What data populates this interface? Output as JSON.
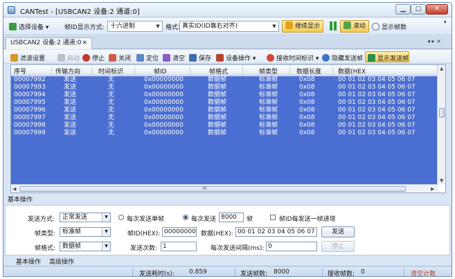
{
  "window": {
    "title": "CANTest - [USBCAN2 设备:2 通道:0]"
  },
  "toolbar1": {
    "select_device": "选择设备",
    "id_display_label": "帧ID显示方式:",
    "id_display_value": "十六进制",
    "format_label": "格式:",
    "format_value": "真实ID(ID靠右对齐)",
    "continue_display": "继续显示",
    "scroll": "滚动",
    "show_frame_count": "显示帧数"
  },
  "doc_tab": {
    "label": "USBCAN2 设备:2 通道:0",
    "close": "×",
    "nav": "◂ ▸ ×"
  },
  "toolbar2": {
    "filter_settings": "滤波设置",
    "start": "启动",
    "stop": "停止",
    "close": "关闭",
    "locate": "定位",
    "clear": "清空",
    "save": "保存",
    "device_ops": "设备操作",
    "recv_time_label": "接收时间标识",
    "hide_send": "隐藏发送帧",
    "show_send": "显示发送帧"
  },
  "grid": {
    "columns": [
      "序号",
      "传输方向",
      "时间标识",
      "帧ID",
      "帧格式",
      "帧类型",
      "数据长度",
      "数据(HEX"
    ],
    "rows": [
      [
        "00007992",
        "发送",
        "无",
        "0x00000000",
        "数据帧",
        "标准帧",
        "0x08",
        "00 01 02 03 04 05 06 07"
      ],
      [
        "00007993",
        "发送",
        "无",
        "0x00000000",
        "数据帧",
        "标准帧",
        "0x08",
        "00 01 02 03 04 05 06 07"
      ],
      [
        "00007994",
        "发送",
        "无",
        "0x00000000",
        "数据帧",
        "标准帧",
        "0x08",
        "00 01 02 03 04 05 06 07"
      ],
      [
        "00007995",
        "发送",
        "无",
        "0x00000000",
        "数据帧",
        "标准帧",
        "0x08",
        "00 01 02 03 04 05 06 07"
      ],
      [
        "00007996",
        "发送",
        "无",
        "0x00000000",
        "数据帧",
        "标准帧",
        "0x08",
        "00 01 02 03 04 05 06 07"
      ],
      [
        "00007997",
        "发送",
        "无",
        "0x00000000",
        "数据帧",
        "标准帧",
        "0x08",
        "00 01 02 03 04 05 06 07"
      ],
      [
        "00007998",
        "发送",
        "无",
        "0x00000000",
        "数据帧",
        "标准帧",
        "0x08",
        "00 01 02 03 04 05 06 07"
      ],
      [
        "00007999",
        "发送",
        "无",
        "0x00000000",
        "数据帧",
        "标准帧",
        "0x08",
        "00 01 02 03 04 05 06 07"
      ]
    ],
    "hscroll_mid": "III"
  },
  "panel": {
    "title": "基本操作",
    "send_mode_label": "发送方式:",
    "send_mode_value": "正常发送",
    "send_single": "每次发送单帧",
    "send_n_label": "每次发送",
    "send_n_value": "8000",
    "send_n_unit": "帧",
    "id_increment": "帧ID每发送一帧递增",
    "frame_type_label": "帧类型:",
    "frame_type_value": "标准帧",
    "frame_id_label": "帧ID(HEX):",
    "frame_id_value": "00000000",
    "data_label": "数据(HEX):",
    "data_value": "00 01 02 03 04 05 06 07",
    "send_button": "发送",
    "frame_format_label": "帧格式:",
    "frame_format_value": "数据帧",
    "send_count_label": "发送次数:",
    "send_count_value": "1",
    "interval_label": "每次发送间隔(ms):",
    "interval_value": "0",
    "stop_button": "停止"
  },
  "bottom_tabs": [
    "基本操作",
    "高级操作"
  ],
  "status": {
    "elapsed_label": "发送耗时(s):",
    "elapsed_value": "0.859",
    "sent_label": "发送帧数:",
    "sent_value": "8000",
    "recv_label": "接收帧数:",
    "recv_value": "0",
    "clear_count": "清空计数"
  },
  "colors": {
    "selection": "#4a6ed1",
    "accent": "#f5c94d",
    "frame": "#d9e6f5"
  }
}
